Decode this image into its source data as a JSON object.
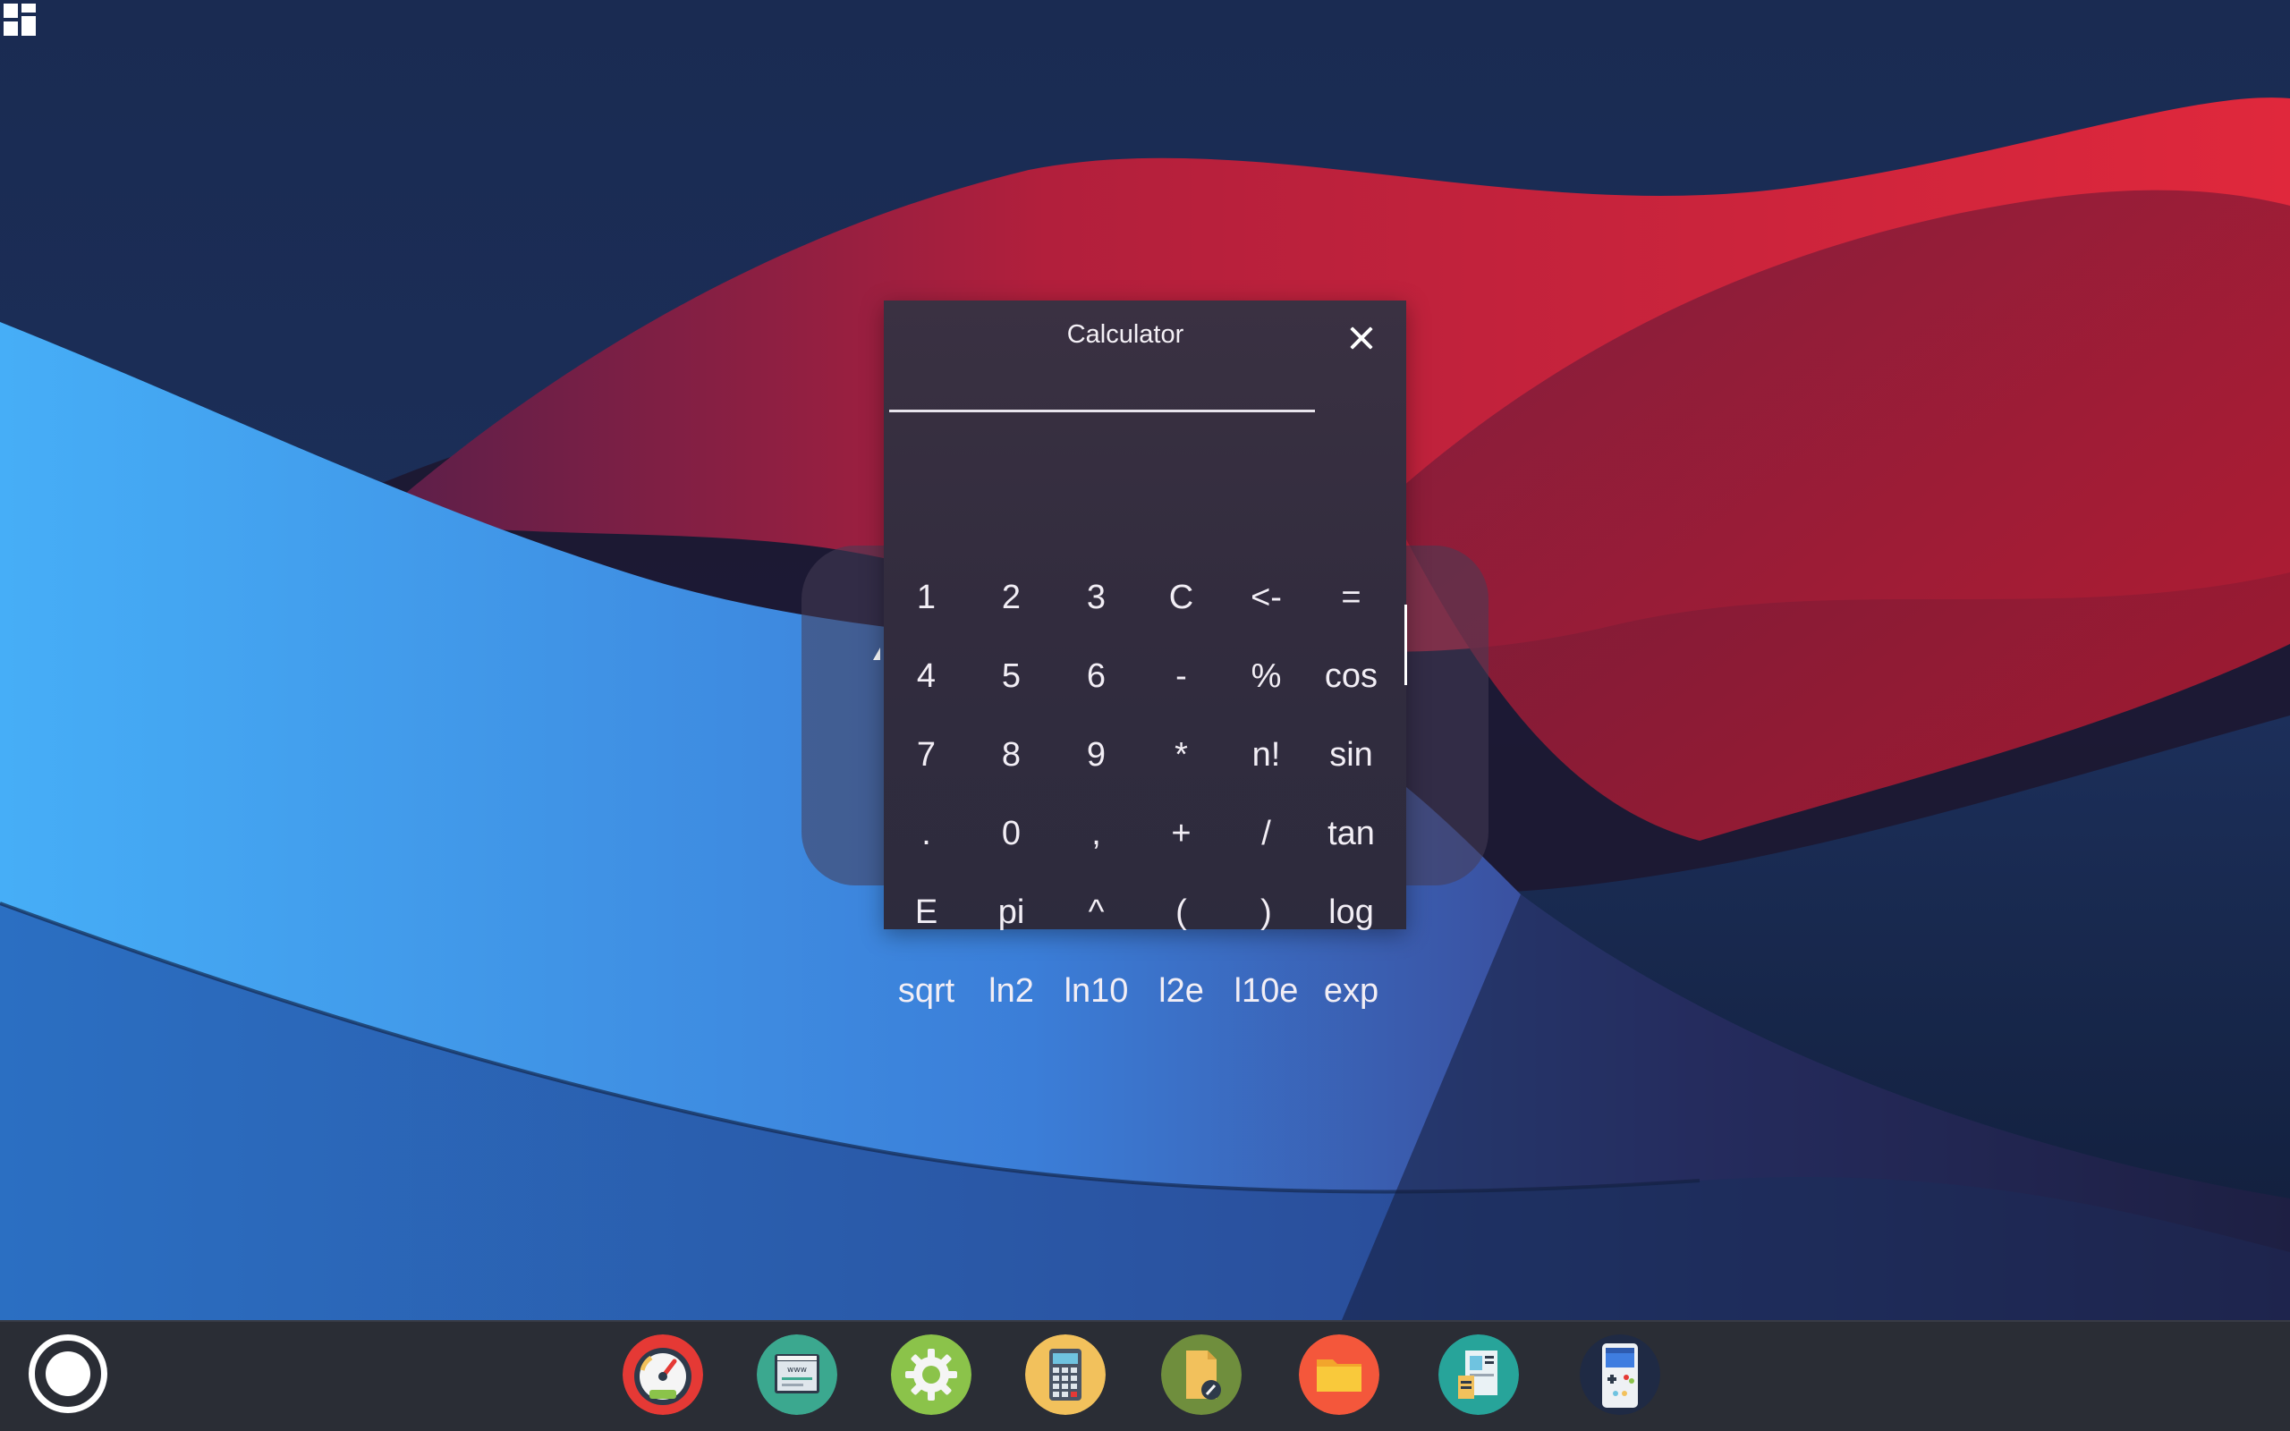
{
  "desktop": {
    "apps_grid_icon": "apps-grid-icon"
  },
  "calculator": {
    "title": "Calculator",
    "display_value": "",
    "close_icon": "close-icon",
    "keys": [
      [
        "1",
        "2",
        "3",
        "C",
        "<-",
        "="
      ],
      [
        "4",
        "5",
        "6",
        "-",
        "%",
        "cos"
      ],
      [
        "7",
        "8",
        "9",
        "*",
        "n!",
        "sin"
      ],
      [
        ".",
        "0",
        ",",
        "+",
        "/",
        "tan"
      ],
      [
        "E",
        "pi",
        "^",
        "(",
        ")",
        "log"
      ],
      [
        "sqrt",
        "ln2",
        "ln10",
        "l2e",
        "l10e",
        "exp"
      ]
    ]
  },
  "dock": {
    "home_icon": "home-circle-icon",
    "apps": [
      {
        "name": "speedometer-app-icon",
        "bg": "#e53935"
      },
      {
        "name": "browser-app-icon",
        "bg": "#3ba88f"
      },
      {
        "name": "settings-app-icon",
        "bg": "#8bc34a"
      },
      {
        "name": "calculator-app-icon",
        "bg": "#f2c15c"
      },
      {
        "name": "notes-app-icon",
        "bg": "#6f8e3d"
      },
      {
        "name": "files-app-icon",
        "bg": "#f4573b"
      },
      {
        "name": "news-app-icon",
        "bg": "#27a49a"
      },
      {
        "name": "game-console-app-icon",
        "bg": "#1f2a44"
      }
    ]
  },
  "colors": {
    "dock_bg": "#2a2d35",
    "calc_bg": "#342e40",
    "wallpaper_red": "#d42436",
    "wallpaper_blue": "#3fa0f0"
  }
}
